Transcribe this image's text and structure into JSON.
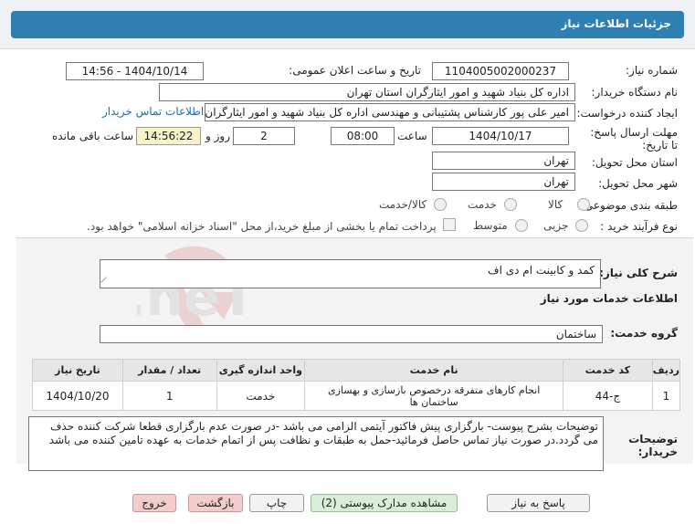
{
  "header": {
    "title": "جزئیات اطلاعات نیاز"
  },
  "fields": {
    "need_number_label": "شماره نیاز:",
    "need_number": "1104005002000237",
    "announce_label": "تاریخ و ساعت اعلان عمومی:",
    "announce_value": "1404/10/14 - 14:56",
    "buyer_org_label": "نام دستگاه خریدار:",
    "buyer_org": "اداره کل بنیاد شهید و امور ایثارگران استان تهران",
    "creator_label": "ایجاد کننده درخواست:",
    "creator": "امیر علی پور کارشناس پشتیبانی و مهندسی اداره کل بنیاد شهید و امور ایثارگران",
    "contact_link": "اطلاعات تماس خریدار",
    "deadline_label": "مهلت ارسال پاسخ: تا تاریخ:",
    "deadline_date": "1404/10/17",
    "time_label": "ساعت",
    "deadline_time": "08:00",
    "days_value": "2",
    "days_label": "روز و",
    "remaining_time": "14:56:22",
    "remaining_label": "ساعت باقی مانده",
    "province_label": "استان محل تحویل:",
    "province": "تهران",
    "city_label": "شهر محل تحویل:",
    "city": "تهران",
    "category_label": "طبقه بندی موضوعی:",
    "category_options": [
      "کالا",
      "خدمت",
      "کالا/خدمت"
    ],
    "purchase_type_label": "نوع فرآیند خرید :",
    "purchase_options": [
      "جزیی",
      "متوسط"
    ],
    "payment_note": "پرداخت تمام یا بخشی از مبلغ خرید،از محل \"اسناد خزانه اسلامی\" خواهد بود."
  },
  "summary": {
    "label": "شرح کلی نیاز:",
    "value": "کمد و کابینت ام دی اف"
  },
  "services_info_title": "اطلاعات خدمات مورد نیاز",
  "service_group": {
    "label": "گروه خدمت:",
    "value": "ساختمان"
  },
  "table": {
    "headers": [
      "ردیف",
      "کد خدمت",
      "نام خدمت",
      "واحد اندازه گیری",
      "تعداد / مقدار",
      "تاریخ نیاز"
    ],
    "rows": [
      [
        "1",
        "ج-44",
        "انجام کارهای متفرقه درخصوص بازسازی و بهسازی ساختمان ها",
        "خدمت",
        "1",
        "1404/10/20"
      ]
    ]
  },
  "buyer_notes": {
    "label": "توضیحات خریدار:",
    "value": "توضیحات بشرح پیوست- بارگزاری پیش فاکتور آیتمی الزامی می باشد -در صورت عدم بارگزاری قطعا شرکت کننده حذف می گردد.در صورت نیاز تماس حاصل فرمائید-حمل به طبقات و نظافت پس از اتمام خدمات به عهده تامین کننده می باشد"
  },
  "buttons": {
    "reply": "پاسخ به نیاز",
    "view_docs": "مشاهده مدارک پیوستی (2)",
    "print": "چاپ",
    "back": "بازگشت",
    "exit": "خروج"
  },
  "watermark": {
    "text": "AriaTender.neT"
  },
  "colors": {
    "header_bar": "#2f7fb3",
    "link": "#1a6bbf",
    "remaining_bg": "#f6f3c8"
  }
}
